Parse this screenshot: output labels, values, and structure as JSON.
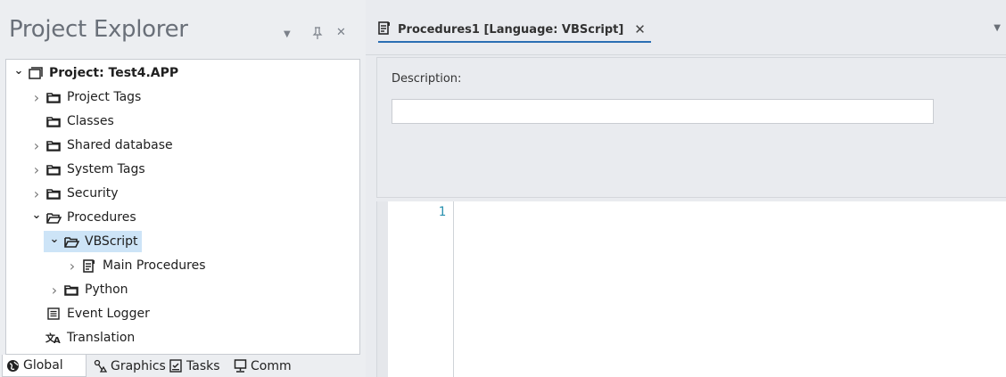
{
  "explorer": {
    "title": "Project Explorer",
    "controls": {
      "dropdown": "▼",
      "pin": "ᵽ",
      "close": "✕"
    },
    "tree": [
      {
        "label": "Project: Test4.APP",
        "bold": true,
        "chev": "open",
        "icon": "project-icon"
      },
      {
        "label": "Project Tags",
        "chev": "closed",
        "icon": "folder-icon"
      },
      {
        "label": "Classes",
        "chev": "none",
        "icon": "folder-icon"
      },
      {
        "label": "Shared database",
        "chev": "closed",
        "icon": "folder-icon"
      },
      {
        "label": "System Tags",
        "chev": "closed",
        "icon": "folder-icon"
      },
      {
        "label": "Security",
        "chev": "closed",
        "icon": "folder-icon"
      },
      {
        "label": "Procedures",
        "chev": "open",
        "icon": "folder-open-icon"
      },
      {
        "label": "VBScript",
        "chev": "open",
        "icon": "folder-open-icon",
        "selected": true
      },
      {
        "label": "Main Procedures",
        "chev": "closed",
        "icon": "script-icon"
      },
      {
        "label": "Python",
        "chev": "closed",
        "icon": "folder-icon"
      },
      {
        "label": "Event Logger",
        "chev": "none",
        "icon": "list-icon"
      },
      {
        "label": "Translation",
        "chev": "none",
        "icon": "translate-icon"
      }
    ],
    "bottom_tabs": [
      {
        "label": "Global",
        "icon": "globe-icon",
        "active": true
      },
      {
        "label": "Graphics",
        "icon": "graphics-icon"
      },
      {
        "label": "Tasks",
        "icon": "tasks-icon"
      },
      {
        "label": "Comm",
        "icon": "comm-icon"
      }
    ]
  },
  "document": {
    "tab_label": "Procedures1 [Language: VBScript]",
    "tab_close": "✕",
    "menu_arrow": "▼",
    "description_label": "Description:",
    "description_value": "",
    "line_number": "1"
  },
  "colors": {
    "accent": "#2b6fb3",
    "selection": "#cde4f7",
    "line_number": "#2b91af"
  }
}
